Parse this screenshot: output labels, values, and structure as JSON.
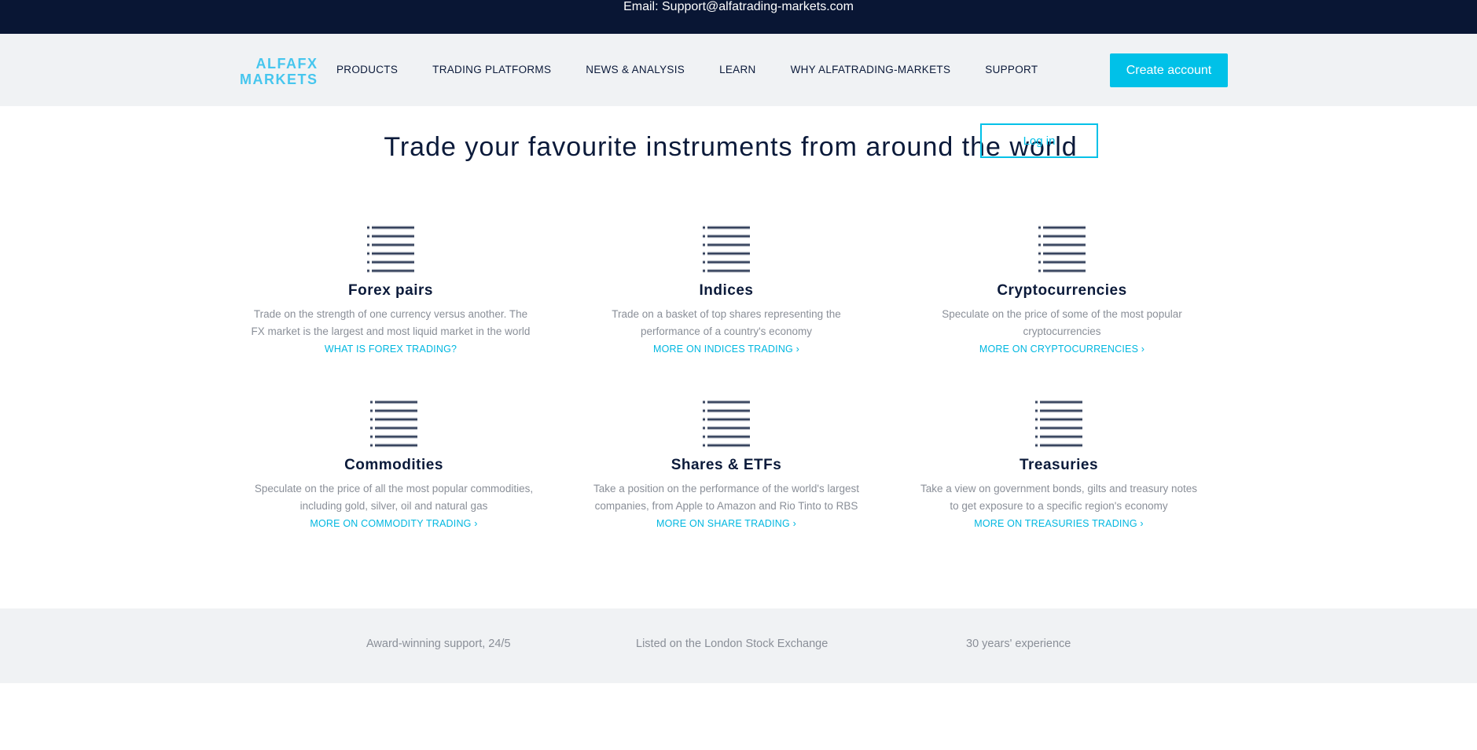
{
  "topbar": {
    "email_text": "Email: Support@alfatrading-markets.com"
  },
  "nav": {
    "logo_line1": "ALFAFX",
    "logo_line2": "MARKETS",
    "items": [
      "PRODUCTS",
      "TRADING PLATFORMS",
      "NEWS & ANALYSIS",
      "LEARN",
      "WHY ALFATRADING-MARKETS",
      "SUPPORT"
    ],
    "create_account": "Create account",
    "login": "Log in"
  },
  "hero": {
    "title": "Trade your favourite instruments from around the world"
  },
  "cards": [
    {
      "title": "Forex pairs",
      "line1": "Trade on the strength of one currency versus another. The",
      "line2": "FX market is the largest and most liquid market in the world",
      "link": "WHAT IS FOREX TRADING?",
      "icon": "list-icon"
    },
    {
      "title": "Indices",
      "line1": "Trade on a basket of top shares representing the",
      "line2": "performance of a country's economy",
      "link": "MORE ON INDICES TRADING ›",
      "icon": "list-icon"
    },
    {
      "title": "Cryptocurrencies",
      "line1": "Speculate on the price of some of the most popular",
      "line2": "cryptocurrencies",
      "link": "MORE ON CRYPTOCURRENCIES ›",
      "icon": "list-icon"
    },
    {
      "title": "Commodities",
      "line1": "Speculate on the price of all the most popular commodities,",
      "line2": "including gold, silver, oil and natural gas",
      "link": "MORE ON COMMODITY TRADING ›",
      "icon": "list-icon"
    },
    {
      "title": "Shares & ETFs",
      "line1": "Take a position on the performance of the world's largest",
      "line2": "companies, from Apple to Amazon and Rio Tinto to RBS",
      "link": "MORE ON SHARE TRADING ›",
      "icon": "list-icon"
    },
    {
      "title": "Treasuries",
      "line1": "Take a view on government bonds, gilts and treasury notes",
      "line2": "to get exposure to a specific region's economy",
      "link": "MORE ON TREASURIES TRADING ›",
      "icon": "list-icon"
    }
  ],
  "band": {
    "item1": "Award-winning support, 24/5",
    "item2": "Listed on the London Stock Exchange",
    "item3": "30 years' experience"
  },
  "colors": {
    "dark": "#091634",
    "accent": "#00c1e8",
    "muted": "#8a8f98",
    "light_bg": "#f0f2f4"
  }
}
